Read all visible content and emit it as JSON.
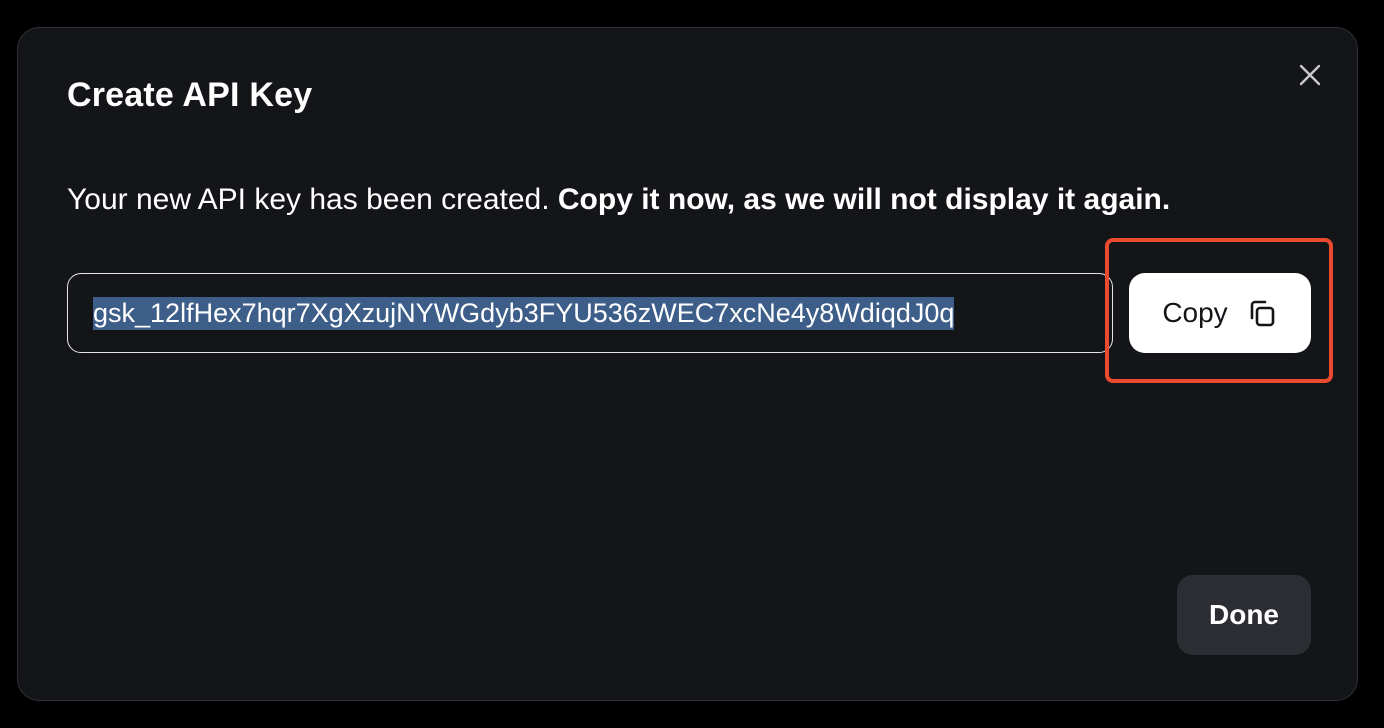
{
  "dialog": {
    "title": "Create API Key",
    "description_normal": "Your new API key has been created. ",
    "description_bold": "Copy it now, as we will not display it again.",
    "api_key": "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",
    "copy_label": "Copy",
    "done_label": "Done"
  },
  "icons": {
    "close": "close-icon",
    "copy": "copy-icon"
  },
  "colors": {
    "background": "#000000",
    "modal": "#141519",
    "selection": "#3e5e8a",
    "highlight": "#ea4a2e",
    "primary_button": "#ffffff",
    "secondary_button": "#2d2e33"
  }
}
